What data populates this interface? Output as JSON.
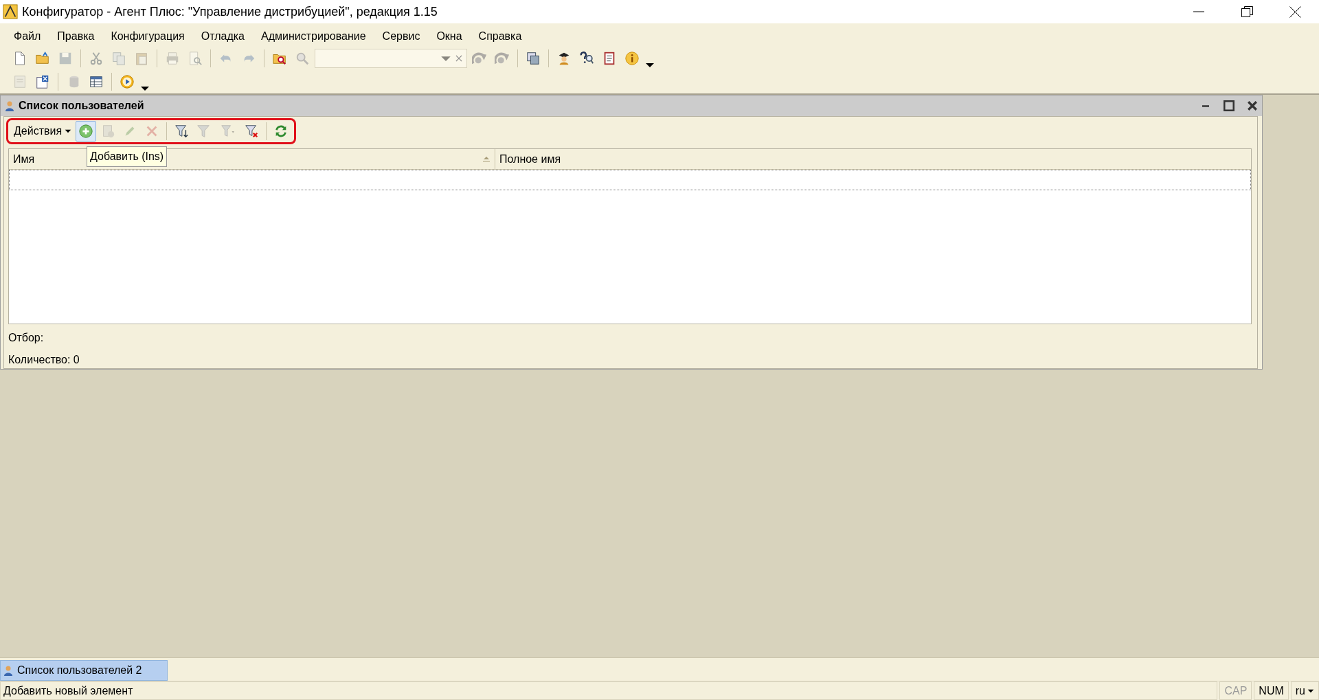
{
  "window": {
    "title": "Конфигуратор - Агент Плюс: \"Управление дистрибуцией\", редакция 1.15"
  },
  "menu": [
    "Файл",
    "Правка",
    "Конфигурация",
    "Отладка",
    "Администрирование",
    "Сервис",
    "Окна",
    "Справка"
  ],
  "toolbar_1": [
    {
      "kind": "new",
      "disabled": false
    },
    {
      "kind": "open",
      "disabled": false
    },
    {
      "kind": "save",
      "disabled": true
    },
    {
      "kind": "sep"
    },
    {
      "kind": "cut",
      "disabled": true
    },
    {
      "kind": "copy",
      "disabled": true
    },
    {
      "kind": "paste",
      "disabled": true
    },
    {
      "kind": "sep"
    },
    {
      "kind": "print",
      "disabled": true
    },
    {
      "kind": "preview",
      "disabled": true
    },
    {
      "kind": "sep"
    },
    {
      "kind": "undo",
      "disabled": true
    },
    {
      "kind": "redo",
      "disabled": true
    },
    {
      "kind": "sep"
    },
    {
      "kind": "findfolder",
      "disabled": false
    },
    {
      "kind": "search",
      "disabled": true
    },
    {
      "kind": "combo"
    },
    {
      "kind": "back",
      "disabled": true
    },
    {
      "kind": "back",
      "disabled": true
    },
    {
      "kind": "sep"
    },
    {
      "kind": "windows",
      "disabled": false
    },
    {
      "kind": "sep"
    },
    {
      "kind": "person",
      "disabled": false
    },
    {
      "kind": "help",
      "disabled": false
    },
    {
      "kind": "doc",
      "disabled": false
    },
    {
      "kind": "info",
      "disabled": false
    },
    {
      "kind": "caret",
      "disabled": false
    }
  ],
  "toolbar_2": [
    {
      "kind": "form",
      "disabled": true
    },
    {
      "kind": "formx",
      "disabled": false
    },
    {
      "kind": "sep"
    },
    {
      "kind": "db",
      "disabled": true
    },
    {
      "kind": "table",
      "disabled": false
    },
    {
      "kind": "sep"
    },
    {
      "kind": "play",
      "disabled": false
    },
    {
      "kind": "caret",
      "disabled": false
    }
  ],
  "child_window": {
    "title": "Список пользователей",
    "toolbar": {
      "highlighted": true,
      "actions_label": "Действия",
      "buttons": [
        {
          "kind": "add",
          "disabled": false,
          "hovered": true
        },
        {
          "kind": "addcopy",
          "disabled": true,
          "hovered": false
        },
        {
          "kind": "edit",
          "disabled": true,
          "hovered": false
        },
        {
          "kind": "delete",
          "disabled": true,
          "hovered": false
        },
        {
          "kind": "sep"
        },
        {
          "kind": "filter",
          "disabled": false,
          "hovered": false
        },
        {
          "kind": "filterv",
          "disabled": true,
          "hovered": false
        },
        {
          "kind": "filterlist",
          "disabled": true,
          "hovered": false
        },
        {
          "kind": "filteroff",
          "disabled": false,
          "hovered": false
        },
        {
          "kind": "sep"
        },
        {
          "kind": "refresh",
          "disabled": false,
          "hovered": false
        }
      ]
    },
    "tooltip": "Добавить (Ins)",
    "table": {
      "columns": [
        {
          "label": "Имя",
          "sorted": true
        },
        {
          "label": "Полное имя",
          "sorted": false
        }
      ]
    },
    "filter_label": "Отбор:",
    "count_label": "Количество: 0"
  },
  "taskbar": [
    {
      "label": "Список пользователей 2",
      "selected": true
    }
  ],
  "status_bar": {
    "message": "Добавить новый элемент",
    "indicators": [
      {
        "label": "CAP",
        "on": false
      },
      {
        "label": "NUM",
        "on": true
      }
    ],
    "language": "ru"
  }
}
